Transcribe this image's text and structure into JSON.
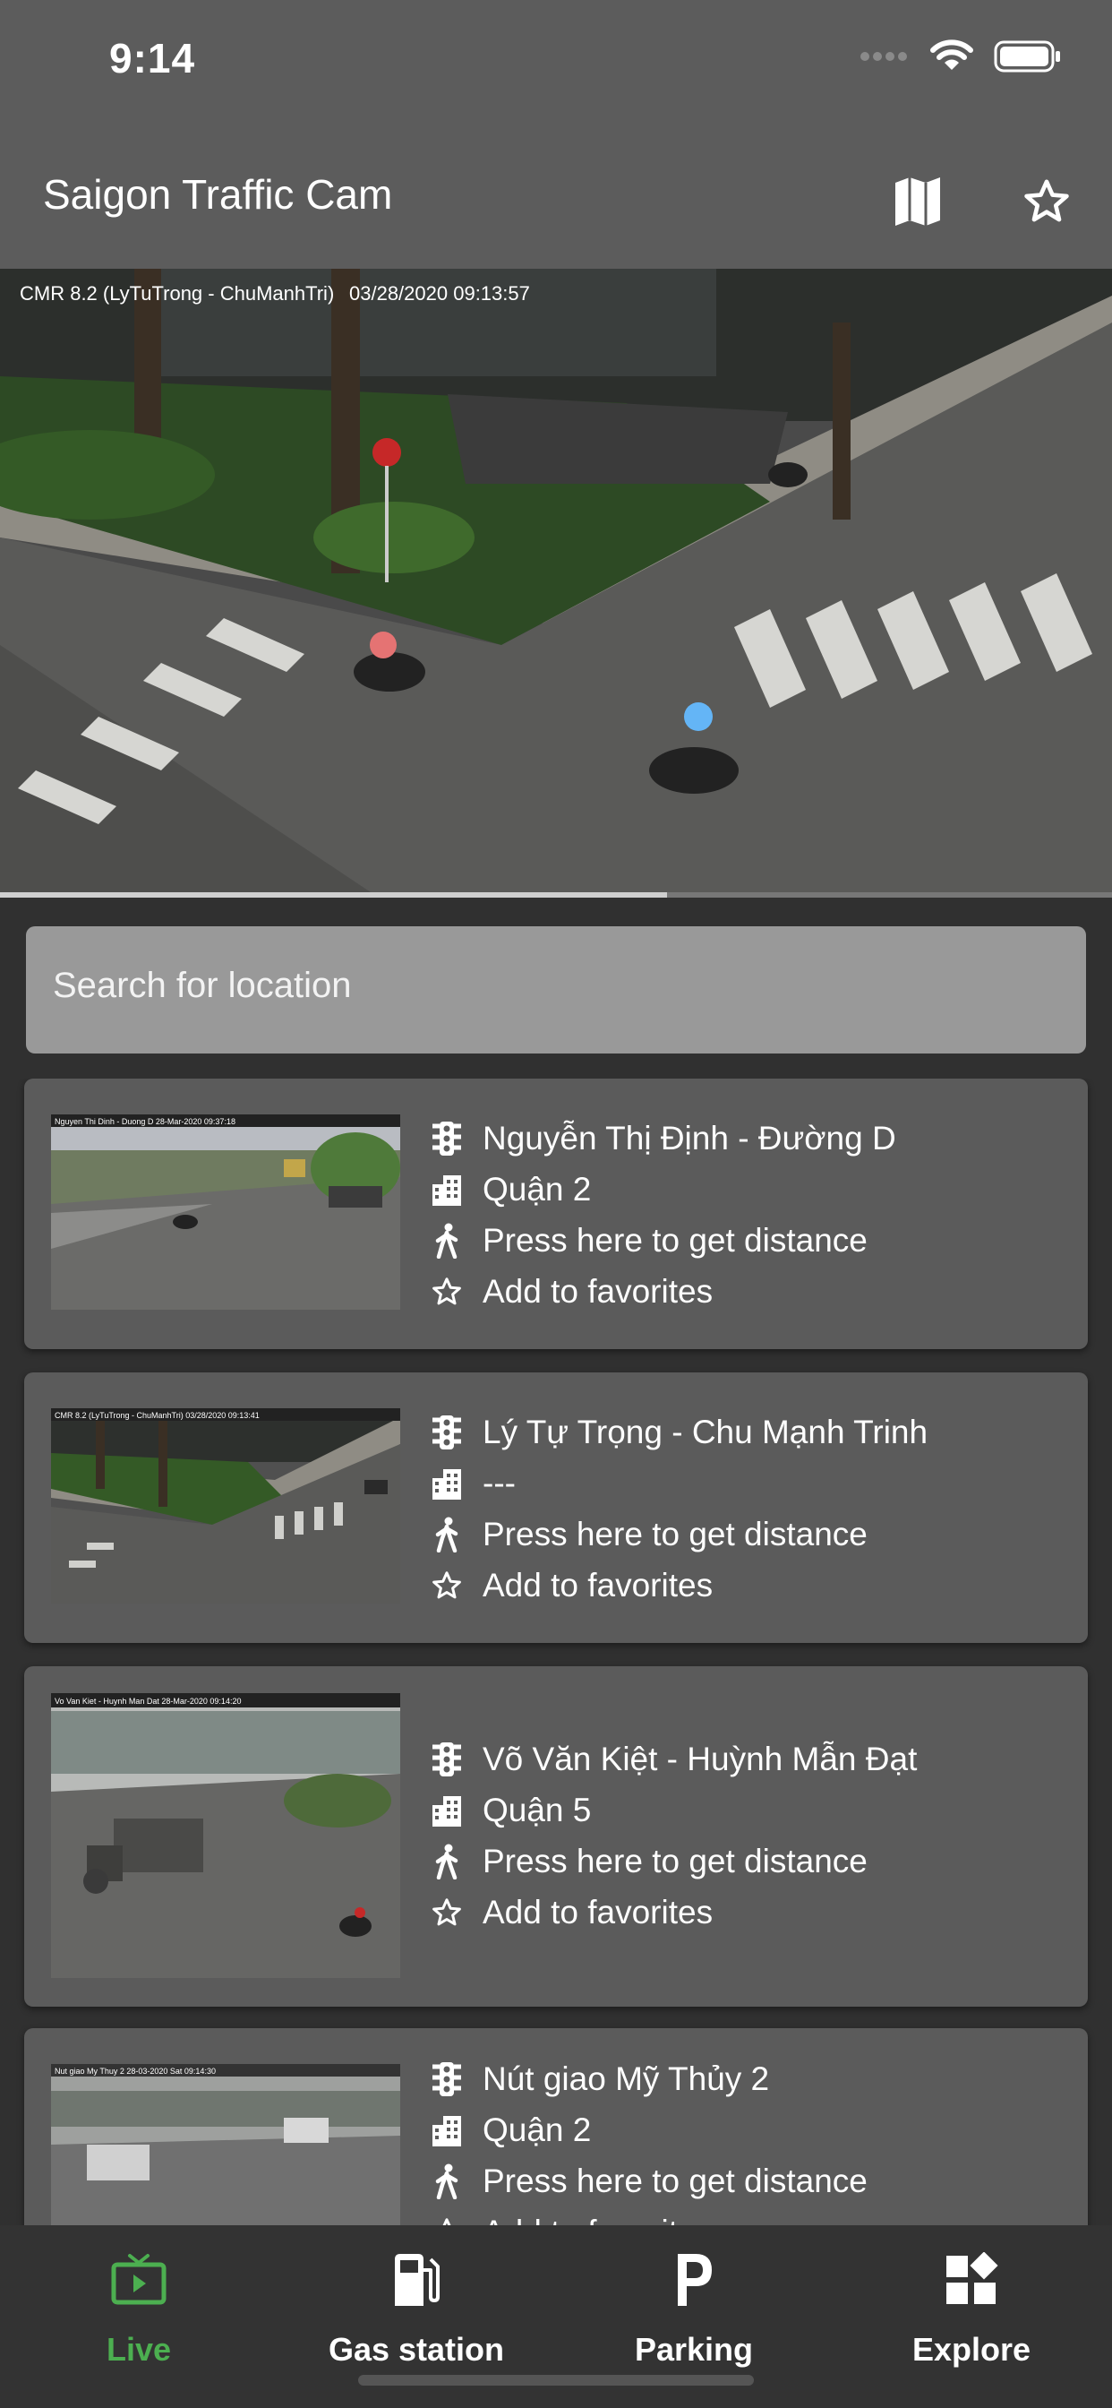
{
  "status_bar": {
    "time": "9:14"
  },
  "app_bar": {
    "title": "Saigon Traffic Cam",
    "map_icon": "map-icon",
    "favorite_icon": "star-outline-icon"
  },
  "hero": {
    "overlay_text": "CMR 8.2 (LyTuTrong - ChuManhTri)",
    "overlay_timestamp": "03/28/2020  09:13:57",
    "progress": 0.6
  },
  "search": {
    "placeholder": "Search for location"
  },
  "cameras": [
    {
      "name": "Nguyễn Thị Định - Đường D",
      "district": "Quận 2",
      "distance": "Press here to get distance",
      "favorite": "Add to favorites",
      "thumb_overlay": "Nguyen Thi Dinh - Duong D    28-Mar-2020  09:37:18"
    },
    {
      "name": "Lý Tự Trọng - Chu Mạnh Trinh",
      "district": "---",
      "distance": "Press here to get distance",
      "favorite": "Add to favorites",
      "thumb_overlay": "CMR 8.2 (LyTuTrong - ChuManhTri)    03/28/2020  09:13:41"
    },
    {
      "name": "Võ Văn Kiệt - Huỳnh Mẫn Đạt",
      "district": "Quận 5",
      "distance": "Press here to get distance",
      "favorite": "Add to favorites",
      "thumb_overlay": "Vo Van Kiet - Huynh Man Dat    28-Mar-2020  09:14:20"
    },
    {
      "name": "Nút giao Mỹ Thủy 2",
      "district": "Quận 2",
      "distance": "Press here to get distance",
      "favorite": "Add to favorites",
      "thumb_overlay": "Nut giao My Thuy 2    28-03-2020 Sat 09:14:30"
    }
  ],
  "bottom_nav": [
    {
      "label": "Live",
      "icon": "tv-icon",
      "active": true
    },
    {
      "label": "Gas station",
      "icon": "gas-pump-icon",
      "active": false
    },
    {
      "label": "Parking",
      "icon": "parking-icon",
      "active": false
    },
    {
      "label": "Explore",
      "icon": "explore-widgets-icon",
      "active": false
    }
  ],
  "colors": {
    "appbar": "#5c5c5c",
    "background": "#303030",
    "card": "#5b5b5b",
    "search": "#999999",
    "active": "#4caf50"
  }
}
